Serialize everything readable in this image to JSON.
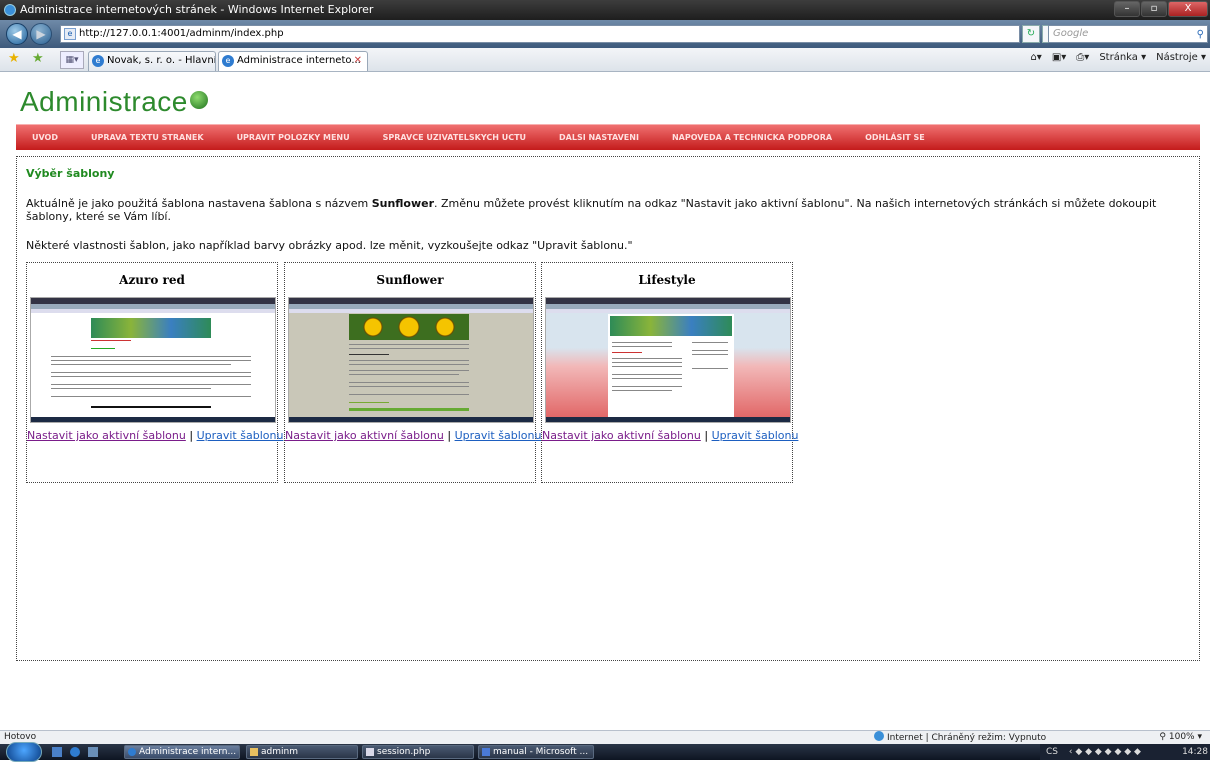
{
  "window": {
    "title": "Administrace internetových stránek - Windows Internet Explorer",
    "buttons": [
      "–",
      "▫",
      "X"
    ]
  },
  "address": {
    "url": "http://127.0.0.1:4001/adminm/index.php",
    "search_placeholder": "Google"
  },
  "tabs": [
    {
      "label": "Novak, s. r. o. - Hlavní strá...",
      "active": false
    },
    {
      "label": "Administrace interneto...",
      "active": true
    }
  ],
  "command_bar": {
    "page": "Stránka ▾",
    "tools": "Nástroje ▾"
  },
  "site": {
    "logo": "Administrace",
    "menu": [
      "UVOD",
      "UPRAVA TEXTU STRANEK",
      "UPRAVIT POLOZKY MENU",
      "SPRAVCE UZIVATELSKYCH UCTU",
      "DALSI NASTAVENI",
      "NAPOVEDA A TECHNICKA PODPORA",
      "ODHLÁSIT SE"
    ]
  },
  "content": {
    "heading": "Výběr šablony",
    "p1_before": "Aktuálně je jako použitá šablona nastavena šablona s názvem ",
    "p1_bold": "Sunflower",
    "p1_after": ". Změnu můžete provést kliknutím na odkaz \"Nastavit jako aktivní šablonu\". Na našich internetových stránkách si můžete dokoupit šablony, které se Vám líbí.",
    "p2": "Některé vlastnosti šablon, jako například barvy obrázky apod. lze měnit, vyzkoušejte odkaz \"Upravit šablonu.\"",
    "templates": [
      {
        "name": "Azuro red",
        "activate": "Nastavit jako aktivní šablonu",
        "edit": "Upravit šablonu"
      },
      {
        "name": "Sunflower",
        "activate": "Nastavit jako aktivní šablonu",
        "edit": "Upravit šablonu"
      },
      {
        "name": "Lifestyle",
        "activate": "Nastavit jako aktivní šablonu",
        "edit": "Upravit šablonu"
      }
    ],
    "separator": "|"
  },
  "status": {
    "left": "Hotovo",
    "zone": "Internet | Chráněný režim: Vypnuto",
    "zoom": "100%"
  },
  "taskbar": {
    "items": [
      "Administrace intern...",
      "adminm",
      "session.php",
      "manual - Microsoft ..."
    ],
    "tray_lang": "CS",
    "clock": "14:28"
  }
}
